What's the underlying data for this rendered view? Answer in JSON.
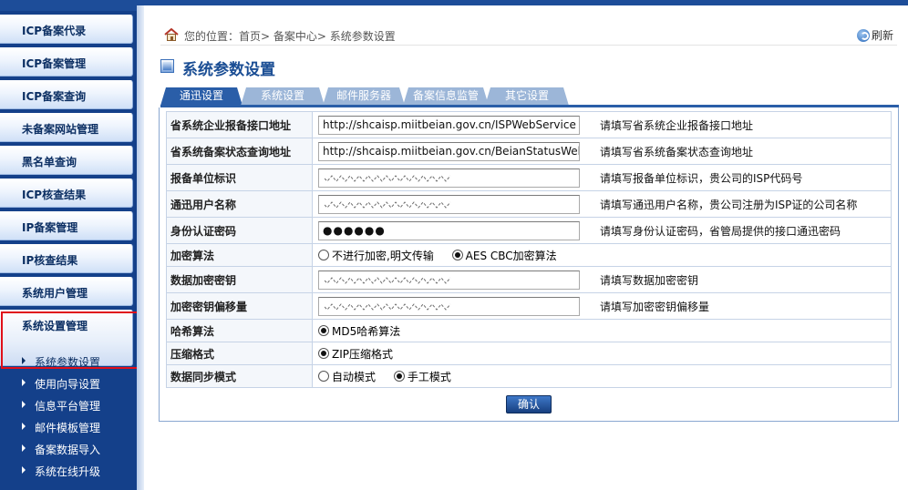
{
  "sidebar": {
    "items": [
      {
        "label": "ICP备案代录"
      },
      {
        "label": "ICP备案管理"
      },
      {
        "label": "ICP备案查询"
      },
      {
        "label": "未备案网站管理"
      },
      {
        "label": "黑名单查询"
      },
      {
        "label": "ICP核查结果"
      },
      {
        "label": "IP备案管理"
      },
      {
        "label": "IP核查结果"
      },
      {
        "label": "系统用户管理"
      },
      {
        "label": "系统设置管理"
      }
    ],
    "sub_items": [
      {
        "label": "系统参数设置"
      },
      {
        "label": "使用向导设置"
      },
      {
        "label": "信息平台管理"
      },
      {
        "label": "邮件模板管理"
      },
      {
        "label": "备案数据导入"
      },
      {
        "label": "系统在线升级"
      }
    ]
  },
  "breadcrumb": {
    "text": "您的位置：首页> 备案中心> 系统参数设置",
    "refresh_label": "刷新"
  },
  "page_title": "系统参数设置",
  "tabs": [
    {
      "label": "通迅设置"
    },
    {
      "label": "系统设置"
    },
    {
      "label": "邮件服务器"
    },
    {
      "label": "备案信息监管"
    },
    {
      "label": "其它设置"
    }
  ],
  "form": {
    "rows": [
      {
        "label": "省系统企业报备接口地址",
        "value": "http://shcaisp.miitbeian.gov.cn/ISPWebService",
        "hint": "请填写省系统企业报备接口地址"
      },
      {
        "label": "省系统备案状态查询地址",
        "value": "http://shcaisp.miitbeian.gov.cn/BeianStatusWebService",
        "hint": "请填写省系统备案状态查询地址"
      },
      {
        "label": "报备单位标识",
        "value": "",
        "hint": "请填写报备单位标识，贵公司的ISP代码号"
      },
      {
        "label": "通迅用户名称",
        "value": "",
        "hint": "请填写通迅用户名称，贵公司注册为ISP证的公司名称"
      },
      {
        "label": "身份认证密码",
        "value": "●●●●●●",
        "hint": "请填写身份认证密码，省管局提供的接口通迅密码"
      },
      {
        "label": "加密算法",
        "options": [
          "不进行加密,明文传输",
          "AES CBC加密算法"
        ]
      },
      {
        "label": "数据加密密钥",
        "value": "",
        "hint": "请填写数据加密密钥"
      },
      {
        "label": "加密密钥偏移量",
        "value": "",
        "hint": "请填写加密密钥偏移量"
      },
      {
        "label": "哈希算法",
        "options": [
          "MD5哈希算法"
        ]
      },
      {
        "label": "压缩格式",
        "options": [
          "ZIP压缩格式"
        ]
      },
      {
        "label": "数据同步模式",
        "options": [
          "自动模式",
          "手工模式"
        ]
      }
    ],
    "selected": {
      "encryption": "AES CBC加密算法",
      "hash": "MD5哈希算法",
      "compress": "ZIP压缩格式",
      "sync": "手工模式"
    }
  },
  "confirm_label": "确认",
  "colors": {
    "sidebar_bg": "#14408a",
    "accent": "#2a5ea8",
    "title": "#1b4e94",
    "highlight_outline": "#e0101a"
  }
}
